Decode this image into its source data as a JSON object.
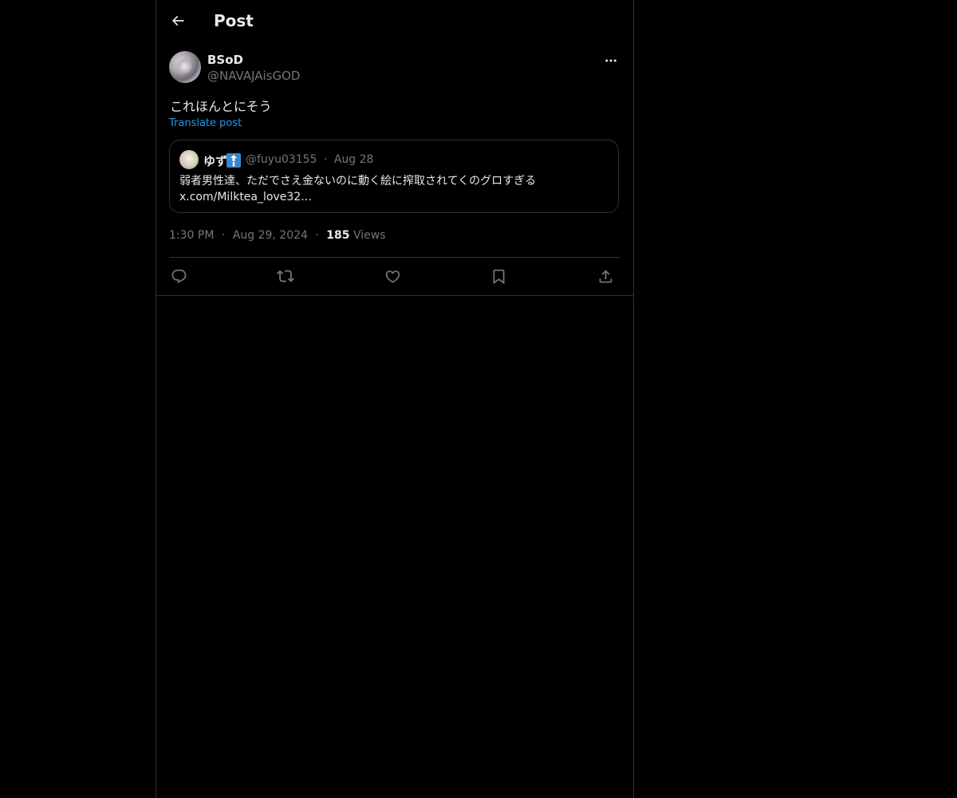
{
  "header": {
    "title": "Post",
    "back_icon": "arrow-left-icon"
  },
  "post": {
    "author": {
      "name": "BSoD",
      "handle": "@NAVAJAisGOD"
    },
    "text": "これほんとにそう",
    "translate_label": "Translate post",
    "quote": {
      "name": "ゆず",
      "emoji_icon": "person-up-arrow-emoji",
      "handle": "@fuyu03155",
      "separator": "·",
      "date": "Aug 28",
      "text": "弱者男性達、ただでさえ金ないのに動く絵に搾取されてくのグロすぎる",
      "link": "x.com/Milktea_love32…"
    },
    "meta": {
      "time": "1:30 PM",
      "separator": "·",
      "date": "Aug 29, 2024",
      "views_count": "185",
      "views_label": "Views"
    }
  },
  "actions": [
    {
      "name": "reply",
      "icon": "reply-icon"
    },
    {
      "name": "repost",
      "icon": "repost-icon"
    },
    {
      "name": "like",
      "icon": "heart-icon"
    },
    {
      "name": "bookmark",
      "icon": "bookmark-icon"
    },
    {
      "name": "share",
      "icon": "share-icon"
    }
  ],
  "colors": {
    "background": "#000000",
    "text": "#e7e9ea",
    "muted": "#71767b",
    "link": "#1d9bf0",
    "border": "#2f3336"
  }
}
